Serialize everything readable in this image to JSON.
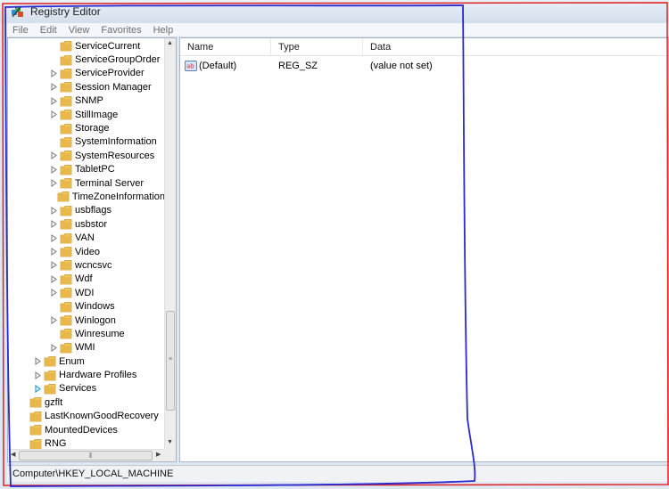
{
  "window": {
    "title": "Registry Editor"
  },
  "menu": [
    "File",
    "Edit",
    "View",
    "Favorites",
    "Help"
  ],
  "tree": {
    "items": [
      {
        "label": "ServiceCurrent",
        "level": 3,
        "expander": "none"
      },
      {
        "label": "ServiceGroupOrder",
        "level": 3,
        "expander": "none"
      },
      {
        "label": "ServiceProvider",
        "level": 3,
        "expander": "collapsed"
      },
      {
        "label": "Session Manager",
        "level": 3,
        "expander": "collapsed"
      },
      {
        "label": "SNMP",
        "level": 3,
        "expander": "collapsed"
      },
      {
        "label": "StillImage",
        "level": 3,
        "expander": "collapsed"
      },
      {
        "label": "Storage",
        "level": 3,
        "expander": "none"
      },
      {
        "label": "SystemInformation",
        "level": 3,
        "expander": "none"
      },
      {
        "label": "SystemResources",
        "level": 3,
        "expander": "collapsed"
      },
      {
        "label": "TabletPC",
        "level": 3,
        "expander": "collapsed"
      },
      {
        "label": "Terminal Server",
        "level": 3,
        "expander": "collapsed"
      },
      {
        "label": "TimeZoneInformation",
        "level": 3,
        "expander": "none"
      },
      {
        "label": "usbflags",
        "level": 3,
        "expander": "collapsed"
      },
      {
        "label": "usbstor",
        "level": 3,
        "expander": "collapsed"
      },
      {
        "label": "VAN",
        "level": 3,
        "expander": "collapsed"
      },
      {
        "label": "Video",
        "level": 3,
        "expander": "collapsed"
      },
      {
        "label": "wcncsvc",
        "level": 3,
        "expander": "collapsed"
      },
      {
        "label": "Wdf",
        "level": 3,
        "expander": "collapsed"
      },
      {
        "label": "WDI",
        "level": 3,
        "expander": "collapsed"
      },
      {
        "label": "Windows",
        "level": 3,
        "expander": "none"
      },
      {
        "label": "Winlogon",
        "level": 3,
        "expander": "collapsed"
      },
      {
        "label": "Winresume",
        "level": 3,
        "expander": "none"
      },
      {
        "label": "WMI",
        "level": 3,
        "expander": "collapsed"
      },
      {
        "label": "Enum",
        "level": 2,
        "expander": "collapsed"
      },
      {
        "label": "Hardware Profiles",
        "level": 2,
        "expander": "collapsed"
      },
      {
        "label": "Services",
        "level": 2,
        "expander": "highlight"
      },
      {
        "label": "gzflt",
        "level": 1,
        "expander": "none"
      },
      {
        "label": "LastKnownGoodRecovery",
        "level": 1,
        "expander": "none"
      },
      {
        "label": "MountedDevices",
        "level": 1,
        "expander": "none"
      },
      {
        "label": "RNG",
        "level": 1,
        "expander": "none"
      }
    ]
  },
  "list": {
    "columns": [
      "Name",
      "Type",
      "Data"
    ],
    "rows": [
      {
        "name": "(Default)",
        "type": "REG_SZ",
        "data": "(value not set)"
      }
    ]
  },
  "status": {
    "path": "Computer\\HKEY_LOCAL_MACHINE"
  },
  "colors": {
    "folder": "#e8b84a",
    "annotation_red": "#e02020",
    "annotation_blue": "#2a2ad0",
    "expander_blue": "#2aa0d8"
  }
}
